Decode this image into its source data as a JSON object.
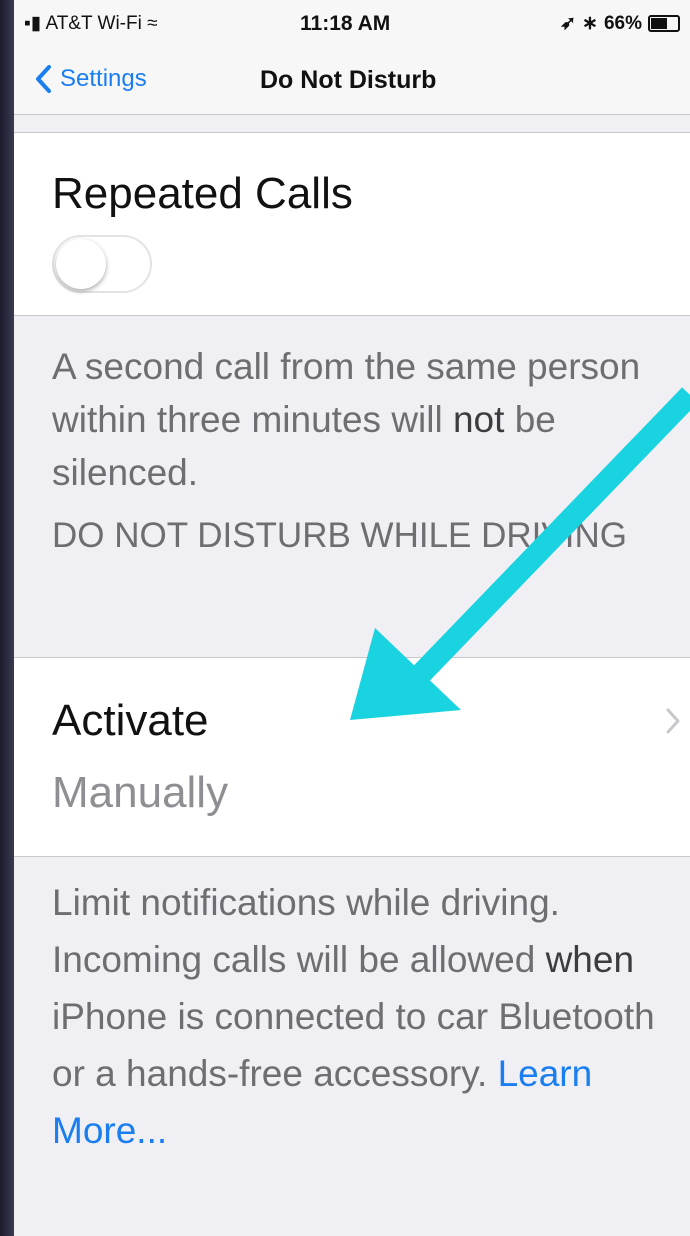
{
  "status_bar": {
    "carrier": "AT&T Wi-Fi",
    "time": "11:18 AM",
    "battery": "66%",
    "battery_level": 0.66
  },
  "nav": {
    "back_label": "Settings",
    "title": "Do Not Disturb"
  },
  "repeated_calls": {
    "label": "Repeated Calls",
    "toggle_on": false
  },
  "repeated_calls_note": {
    "part1": "A second call from the same person within three minutes will ",
    "bold": "not",
    "part2": " be silenced."
  },
  "section_header": "DO NOT DISTURB WHILE DRIVING",
  "activate": {
    "title": "Activate",
    "value": "Manually"
  },
  "driving_note": {
    "part1": "Limit notifications while driving. Incoming calls will be allowed ",
    "bold": "when",
    "part2": " iPhone is connected to car Bluetooth or a hands-free accessory. ",
    "link": "Learn More..."
  },
  "colors": {
    "accent": "#1a7ef0",
    "annotation_arrow": "#19d3e0"
  }
}
